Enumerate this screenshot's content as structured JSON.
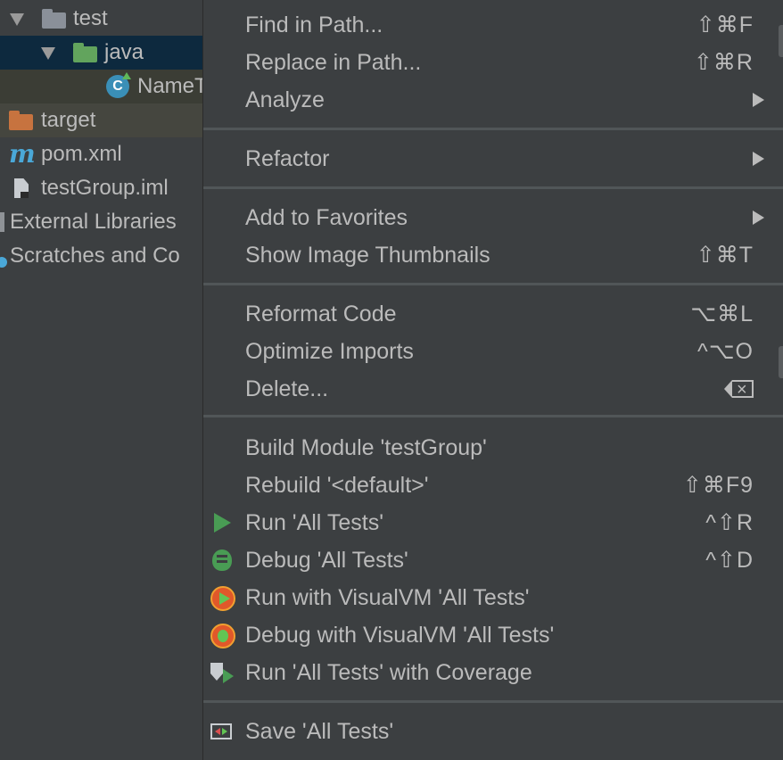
{
  "tree": {
    "items": [
      {
        "label": "test",
        "icon": "folder-icon"
      },
      {
        "label": "java",
        "icon": "test-source-folder-icon"
      },
      {
        "label": "NameT",
        "icon": "java-class-icon"
      },
      {
        "label": "target",
        "icon": "excluded-folder-icon"
      },
      {
        "label": "pom.xml",
        "icon": "maven-icon"
      },
      {
        "label": "testGroup.iml",
        "icon": "module-file-icon"
      },
      {
        "label": "External Libraries",
        "icon": "external-libraries-icon"
      },
      {
        "label": "Scratches and Co",
        "icon": "scratches-icon"
      }
    ],
    "class_icon_letter": "C"
  },
  "menu": {
    "items": [
      {
        "label": "Find in Path...",
        "shortcut": "⇧⌘F"
      },
      {
        "label": "Replace in Path...",
        "shortcut": "⇧⌘R"
      },
      {
        "label": "Analyze",
        "shortcut": ""
      },
      {
        "label": "Refactor",
        "shortcut": ""
      },
      {
        "label": "Add to Favorites",
        "shortcut": ""
      },
      {
        "label": "Show Image Thumbnails",
        "shortcut": "⇧⌘T"
      },
      {
        "label": "Reformat Code",
        "shortcut": "⌥⌘L"
      },
      {
        "label": "Optimize Imports",
        "shortcut": "^⌥O"
      },
      {
        "label": "Delete...",
        "shortcut": ""
      },
      {
        "label": "Build Module 'testGroup'",
        "shortcut": ""
      },
      {
        "label": "Rebuild '<default>'",
        "shortcut": "⇧⌘F9"
      },
      {
        "label": "Run 'All Tests'",
        "shortcut": "^⇧R"
      },
      {
        "label": "Debug 'All Tests'",
        "shortcut": "^⇧D"
      },
      {
        "label": "Run with VisualVM 'All Tests'",
        "shortcut": ""
      },
      {
        "label": "Debug with VisualVM 'All Tests'",
        "shortcut": ""
      },
      {
        "label": "Run 'All Tests' with Coverage",
        "shortcut": ""
      },
      {
        "label": "Save 'All Tests'",
        "shortcut": ""
      }
    ]
  },
  "colors": {
    "background": "#3c3f41",
    "text": "#bbbbbb",
    "selection": "#0d293e",
    "separator": "#515658",
    "run_green": "#499c54"
  }
}
